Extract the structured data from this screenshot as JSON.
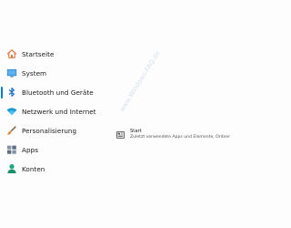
{
  "sidebar": {
    "items": [
      {
        "label": "Startseite",
        "icon": "home-icon"
      },
      {
        "label": "System",
        "icon": "monitor-icon"
      },
      {
        "label": "Bluetooth und Geräte",
        "icon": "bluetooth-icon",
        "selected": true
      },
      {
        "label": "Netzwerk und Internet",
        "icon": "wifi-icon"
      },
      {
        "label": "Personalisierung",
        "icon": "paintbrush-icon"
      },
      {
        "label": "Apps",
        "icon": "apps-icon"
      },
      {
        "label": "Konten",
        "icon": "person-icon"
      }
    ]
  },
  "main": {
    "start": {
      "title": "Start",
      "description": "Zuletzt verwendete Apps und Elemente, Ordner",
      "icon": "start-menu-icon"
    }
  },
  "watermark": "www.Windows-FAQ.de",
  "colors": {
    "accent": "#0078d4",
    "home": "#e07a4f",
    "system": "#2b88d8",
    "bluetooth": "#1f6fc5",
    "network": "#1b9ad6",
    "personalization": "#e2873a",
    "apps": "#6b7a8c",
    "accounts": "#21a87a"
  }
}
